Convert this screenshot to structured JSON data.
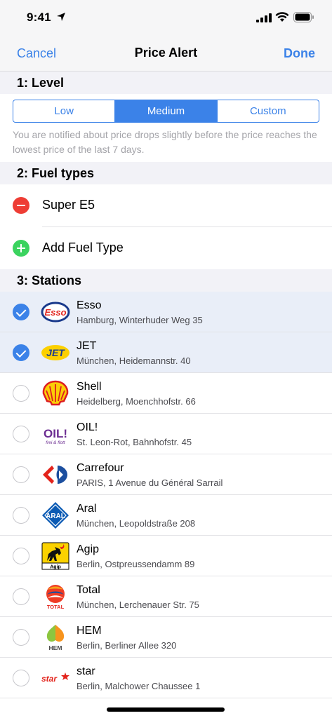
{
  "status": {
    "time": "9:41"
  },
  "nav": {
    "cancel": "Cancel",
    "title": "Price Alert",
    "done": "Done"
  },
  "level": {
    "header": "1: Level",
    "options": [
      "Low",
      "Medium",
      "Custom"
    ],
    "selected": "Medium",
    "description": "You are notified about price drops slightly before the price reaches the lowest price of the last 7 days."
  },
  "fuel": {
    "header": "2: Fuel types",
    "items": [
      {
        "label": "Super E5",
        "icon": "remove-circle-icon"
      }
    ],
    "add_label": "Add Fuel Type"
  },
  "stations": {
    "header": "3: Stations",
    "items": [
      {
        "name": "Esso",
        "address": "Hamburg, Winterhuder Weg 35",
        "selected": true,
        "logo": "esso-logo"
      },
      {
        "name": "JET",
        "address": "München, Heidemannstr. 40",
        "selected": true,
        "logo": "jet-logo"
      },
      {
        "name": "Shell",
        "address": "Heidelberg, Moenchhofstr. 66",
        "selected": false,
        "logo": "shell-logo"
      },
      {
        "name": "OIL!",
        "address": "St. Leon-Rot, Bahnhofstr. 45",
        "selected": false,
        "logo": "oil-logo"
      },
      {
        "name": "Carrefour",
        "address": "PARIS, 1 Avenue du Général Sarrail",
        "selected": false,
        "logo": "carrefour-logo"
      },
      {
        "name": "Aral",
        "address": "München, Leopoldstraße 208",
        "selected": false,
        "logo": "aral-logo"
      },
      {
        "name": "Agip",
        "address": "Berlin, Ostpreussendamm 89",
        "selected": false,
        "logo": "agip-logo"
      },
      {
        "name": "Total",
        "address": "München, Lerchenauer Str. 75",
        "selected": false,
        "logo": "total-logo"
      },
      {
        "name": "HEM",
        "address": "Berlin, Berliner Allee 320",
        "selected": false,
        "logo": "hem-logo"
      },
      {
        "name": "star",
        "address": "Berlin, Malchower Chaussee 1",
        "selected": false,
        "logo": "star-logo"
      }
    ]
  },
  "logo_text": {
    "esso": "Esso",
    "jet": "JET",
    "oil_main": "OIL!",
    "oil_sub": "frei & flott",
    "aral": "ARAL",
    "agip": "Agip",
    "total": "TOTAL",
    "hem": "HEM",
    "star": "star"
  },
  "colors": {
    "accent": "#3b82e8",
    "remove": "#ee3d35",
    "add": "#3bd35f",
    "selected_row": "#e9eef8"
  }
}
